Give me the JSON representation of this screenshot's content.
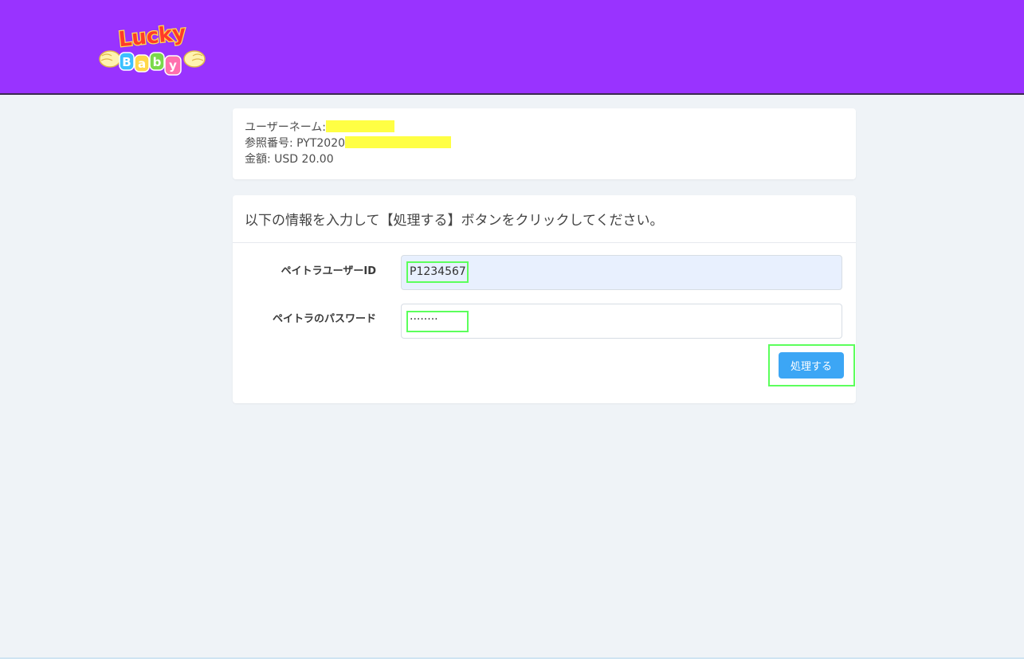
{
  "brand": {
    "logo_line1": "Lucky",
    "logo_line2": "Baby",
    "header_color": "#9933ff"
  },
  "info": {
    "username_label": "ユーザーネーム:",
    "reference_label": "参照番号: PYT2020",
    "amount_label": "金額: USD 20.00"
  },
  "form": {
    "heading": "以下の情報を入力して【処理する】ボタンをクリックしてください。",
    "user_id_label": "ペイトラユーザーID",
    "user_id_value": "P1234567",
    "password_label": "ペイトラのパスワード",
    "password_value": "········",
    "submit_label": "処理する",
    "submit_color": "#3ca6f5",
    "highlight_color": "#5cff5c",
    "redaction_color": "#ffff44"
  }
}
